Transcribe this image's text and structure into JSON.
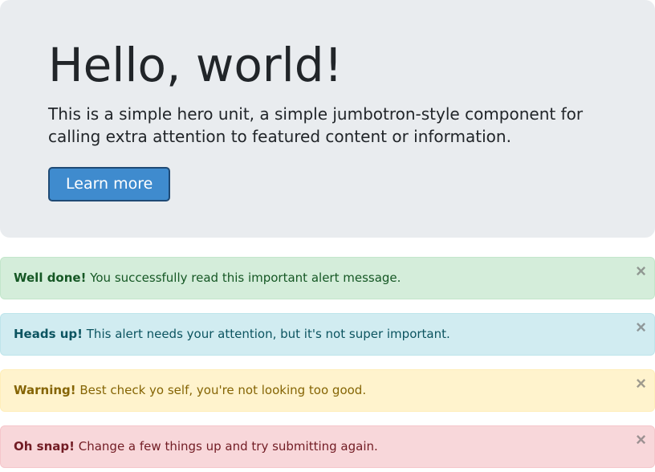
{
  "jumbotron": {
    "heading": "Hello, world!",
    "lead": "This is a simple hero unit, a simple jumbotron-style component for calling extra attention to featured content or information.",
    "button_label": "Learn more"
  },
  "alerts": [
    {
      "type": "success",
      "strong": "Well done!",
      "text": " You successfully read this important alert message."
    },
    {
      "type": "info",
      "strong": "Heads up!",
      "text": " This alert needs your attention, but it's not super important."
    },
    {
      "type": "warning",
      "strong": "Warning!",
      "text": " Best check yo self, you're not looking too good."
    },
    {
      "type": "danger",
      "strong": "Oh snap!",
      "text": " Change a few things up and try submitting again."
    }
  ],
  "close_symbol": "×"
}
